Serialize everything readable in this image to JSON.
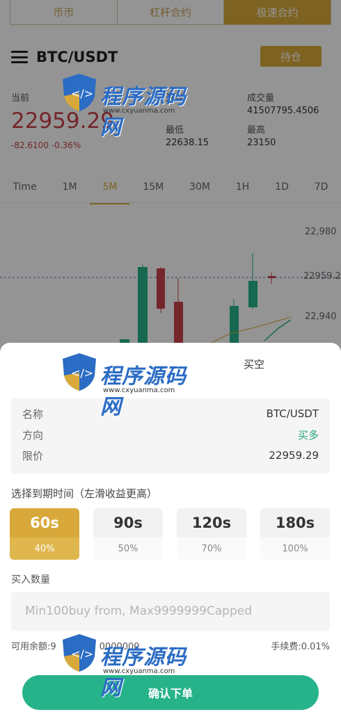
{
  "colors": {
    "accent_gold": "#d8a93a",
    "rise_green": "#27b38a",
    "fall_red": "#c8434a",
    "overlay": "rgba(0,0,0,0.42)"
  },
  "top_tabs": [
    {
      "label": "币币"
    },
    {
      "label": "杠杆合约"
    },
    {
      "label": "极速合约"
    }
  ],
  "header": {
    "pair": "BTC/USDT",
    "position_button": "持仓"
  },
  "stats": {
    "current_label": "当前",
    "current_price": "22959.29",
    "change": "-82.6100 -0.36%",
    "open_label": "开盘",
    "low_label": "最低",
    "low_value": "22638.15",
    "volume_label": "成交量",
    "volume_value": "41507795.4506",
    "high_label": "最高",
    "high_value": "23150"
  },
  "intervals": [
    "Time",
    "1M",
    "5M",
    "15M",
    "30M",
    "1H",
    "1D",
    "7D"
  ],
  "chart_data": {
    "type": "candlestick",
    "y_ticks": [
      "22,980",
      "22959.2",
      "22,940"
    ],
    "current_price_marker": "22959.2"
  },
  "sheet": {
    "title": "买空",
    "info": {
      "name_label": "名称",
      "name_value": "BTC/USDT",
      "direction_label": "方向",
      "direction_value": "买多",
      "limit_label": "限价",
      "limit_value": "22959.29"
    },
    "expiry_label": "选择到期时间（左滑收益更高）",
    "expiry_options": [
      {
        "time": "60s",
        "rate": "40%"
      },
      {
        "time": "90s",
        "rate": "50%"
      },
      {
        "time": "120s",
        "rate": "70%"
      },
      {
        "time": "180s",
        "rate": "100%"
      }
    ],
    "amount_label": "买入数量",
    "amount_placeholder": "Min100buy from, Max9999999Capped",
    "balance_label": "可用余额:9",
    "balance_value": "0000000",
    "fee": "手续费:0.01%",
    "confirm_button": "确认下单"
  },
  "watermark": {
    "text": "程序源码网",
    "url": "www.cxyuanma.com"
  }
}
